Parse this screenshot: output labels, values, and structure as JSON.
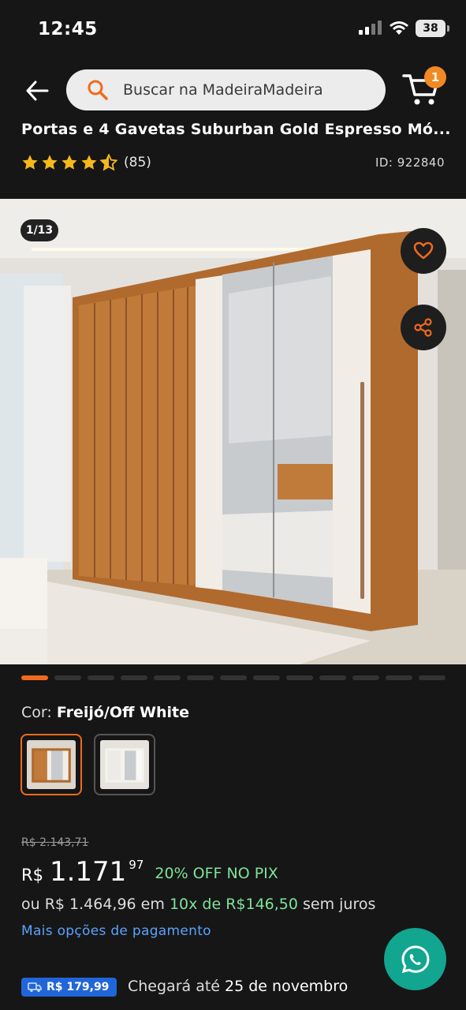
{
  "status_bar": {
    "time": "12:45",
    "battery": "38"
  },
  "header": {
    "search_placeholder": "Buscar na MadeiraMadeira",
    "cart_count": "1"
  },
  "product": {
    "title": "Portas e 4 Gavetas Suburban Gold Espresso Mó...",
    "rating": 4.5,
    "review_count": "(85)",
    "id_label": "ID: 922840"
  },
  "gallery": {
    "counter": "1/13",
    "total_images": 13,
    "current_index": 1
  },
  "color": {
    "label": "Cor:",
    "value": "Freijó/Off White",
    "options": [
      "Freijó/Off White",
      "Off White"
    ]
  },
  "price": {
    "old": "R$ 2.143,71",
    "currency": "R$",
    "integer": "1.171",
    "cents": "97",
    "discount": "20% OFF NO PIX",
    "installment_prefix": "ou R$ 1.464,96 em",
    "installment_highlight": "10x de R$146,50",
    "installment_suffix": "sem juros",
    "more_options": "Mais opções de pagamento"
  },
  "shipping": {
    "price": "R$ 179,99",
    "arrival_prefix": "Chegará até",
    "arrival_date": "25 de novembro"
  },
  "colors": {
    "accent": "#f06a1d",
    "green": "#7fe39a",
    "link": "#5aa2ff",
    "whatsapp": "#12a58f",
    "shipping_tag": "#2166d8"
  }
}
